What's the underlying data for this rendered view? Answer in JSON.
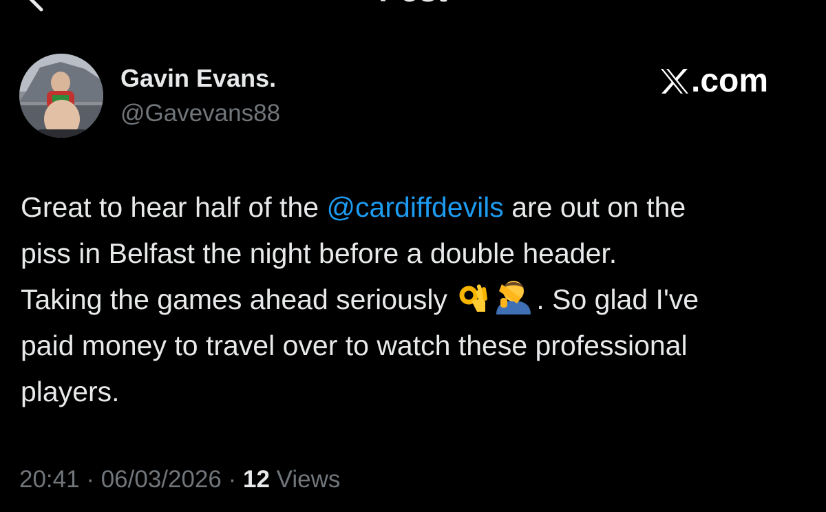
{
  "header": {
    "title": "Post",
    "back_icon": "arrow-left-icon"
  },
  "author": {
    "display_name": "Gavin Evans.",
    "handle": "@Gavevans88",
    "avatar": "profile-photo"
  },
  "brand": {
    "logo_icon": "x-logo-icon",
    "text": ".com"
  },
  "tweet": {
    "line1_before": "Great to hear half of the ",
    "mention": "@cardiffdevils",
    "line1_after": " are out on the",
    "line2": "piss in Belfast the night before a double header.",
    "line3_before": "Taking the games ahead seriously ",
    "emoji_1": "ok-hand-emoji",
    "emoji_2": "facepalm-emoji",
    "line3_after": ". So glad I've",
    "line4": "paid money to travel over to watch these professional",
    "line5": "players."
  },
  "meta": {
    "time": "20:41",
    "separator": " · ",
    "date": "06/03/2026",
    "views_count": "12",
    "views_label": " Views"
  },
  "colors": {
    "background": "#000000",
    "text": "#e7e9ea",
    "secondary": "#71767b",
    "link": "#1d9bf0"
  }
}
